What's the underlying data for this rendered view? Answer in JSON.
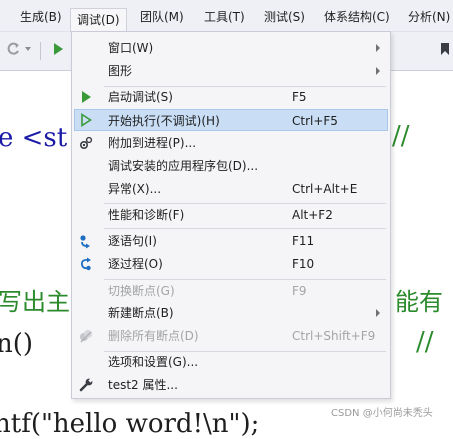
{
  "menubar": {
    "items": [
      {
        "label": "生成(B)"
      },
      {
        "label": "调试(D)"
      },
      {
        "label": "团队(M)"
      },
      {
        "label": "工具(T)"
      },
      {
        "label": "测试(S)"
      },
      {
        "label": "体系结构(C)"
      },
      {
        "label": "分析(N)"
      }
    ],
    "active": "调试(D)"
  },
  "toolbar": {
    "icons": [
      "redo-icon",
      "dropdown-arrow-icon",
      "start-icon",
      "bookmark-icon"
    ]
  },
  "editor": {
    "lines": [
      {
        "text": "e <st",
        "color": "#1a1aa6"
      },
      {
        "text": "n()",
        "color": "#1e1e1e"
      },
      {
        "text": "ntf(\"hello word!\\n\");",
        "color": "#1e1e1e"
      }
    ],
    "comment_slashes_1": "//",
    "comment_slashes_2": "//",
    "comment_slashes_3": "//",
    "green_left": "写出主",
    "green_right": "能有",
    "green_color": "#2b8a2b"
  },
  "debug_menu": {
    "items": [
      {
        "label": "窗口(W)",
        "shortcut": "",
        "submenu": true,
        "disabled": false,
        "icon": ""
      },
      {
        "label": "图形",
        "shortcut": "",
        "submenu": true,
        "disabled": false,
        "icon": ""
      },
      {
        "label": "启动调试(S)",
        "shortcut": "F5",
        "submenu": false,
        "disabled": false,
        "icon": "start-debug-icon"
      },
      {
        "label": "开始执行(不调试)(H)",
        "shortcut": "Ctrl+F5",
        "submenu": false,
        "disabled": false,
        "icon": "start-without-debug-icon"
      },
      {
        "label": "附加到进程(P)...",
        "shortcut": "",
        "submenu": false,
        "disabled": false,
        "icon": "attach-process-icon"
      },
      {
        "label": "调试安装的应用程序包(D)...",
        "shortcut": "",
        "submenu": false,
        "disabled": false,
        "icon": ""
      },
      {
        "label": "异常(X)...",
        "shortcut": "Ctrl+Alt+E",
        "submenu": false,
        "disabled": false,
        "icon": ""
      },
      {
        "label": "性能和诊断(F)",
        "shortcut": "Alt+F2",
        "submenu": false,
        "disabled": false,
        "icon": ""
      },
      {
        "label": "逐语句(I)",
        "shortcut": "F11",
        "submenu": false,
        "disabled": false,
        "icon": "step-into-icon"
      },
      {
        "label": "逐过程(O)",
        "shortcut": "F10",
        "submenu": false,
        "disabled": false,
        "icon": "step-over-icon"
      },
      {
        "label": "切换断点(G)",
        "shortcut": "F9",
        "submenu": false,
        "disabled": true,
        "icon": ""
      },
      {
        "label": "新建断点(B)",
        "shortcut": "",
        "submenu": true,
        "disabled": false,
        "icon": ""
      },
      {
        "label": "删除所有断点(D)",
        "shortcut": "Ctrl+Shift+F9",
        "submenu": false,
        "disabled": true,
        "icon": "delete-breakpoints-icon"
      },
      {
        "label": "选项和设置(G)...",
        "shortcut": "",
        "submenu": false,
        "disabled": false,
        "icon": ""
      },
      {
        "label": "test2 属性...",
        "shortcut": "",
        "submenu": false,
        "disabled": false,
        "icon": "wrench-icon"
      }
    ],
    "hovered": "开始执行(不调试)(H)"
  },
  "watermark": "CSDN @小何尚未秃头",
  "colors": {
    "menu_bg": "#f5f5f7",
    "hover_bg": "#c9def5",
    "play_green": "#3a9a3a",
    "disabled_text": "#a2a4a5",
    "step_blue": "#1f6fc1"
  }
}
